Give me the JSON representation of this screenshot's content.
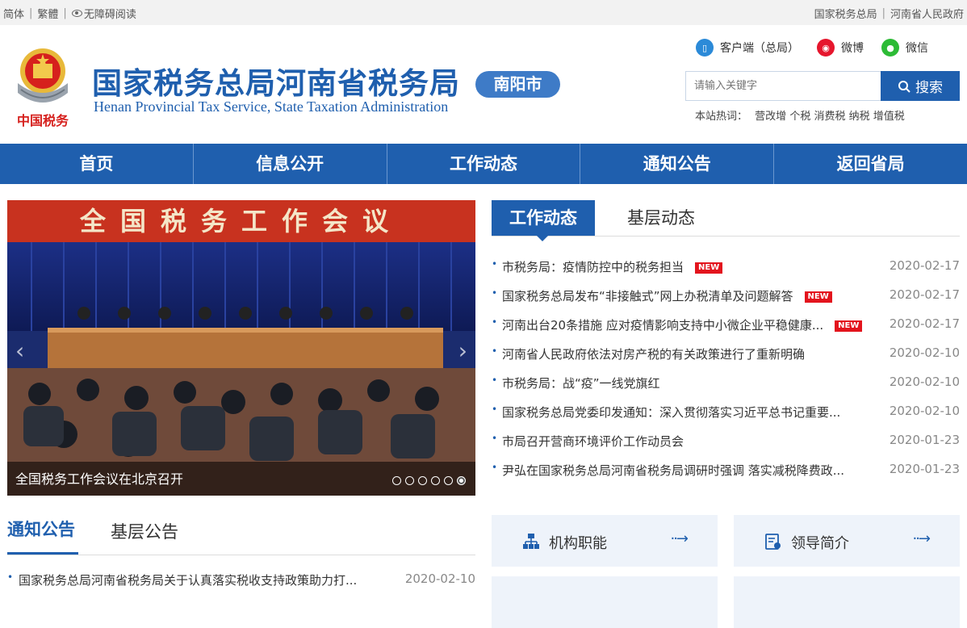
{
  "topbar": {
    "simplified": "简体",
    "traditional": "繁體",
    "accessibility": "无障碍阅读",
    "link_sat": "国家税务总局",
    "link_gov": "河南省人民政府"
  },
  "header": {
    "title": "国家税务总局河南省税务局",
    "title_en": "Henan Provincial Tax Service, State Taxation Administration",
    "city": "南阳市",
    "emblem_text": "中国税务",
    "client_link": "客户端（总局）",
    "weibo_link": "微博",
    "wechat_link": "微信"
  },
  "search": {
    "placeholder": "请输入关键字",
    "button": "搜索",
    "hot_label": "本站热词：",
    "hot_words": [
      "营改增",
      "个税",
      "消费税",
      "纳税",
      "增值税"
    ]
  },
  "nav": [
    "首页",
    "信息公开",
    "工作动态",
    "通知公告",
    "返回省局"
  ],
  "slider": {
    "banner_text": "全国税务工作会议",
    "caption": "全国税务工作会议在北京召开",
    "dot_count": 6,
    "active_dot": 5
  },
  "news": {
    "tab_active": "工作动态",
    "tab_other": "基层动态",
    "new_label": "NEW",
    "items": [
      {
        "title": "市税务局：疫情防控中的税务担当",
        "date": "2020-02-17",
        "is_new": true
      },
      {
        "title": "国家税务总局发布“非接触式”网上办税清单及问题解答",
        "date": "2020-02-17",
        "is_new": true
      },
      {
        "title": "河南出台20条措施 应对疫情影响支持中小微企业平稳健康...",
        "date": "2020-02-17",
        "is_new": true
      },
      {
        "title": "河南省人民政府依法对房产税的有关政策进行了重新明确",
        "date": "2020-02-10",
        "is_new": false
      },
      {
        "title": "市税务局：战“疫”一线党旗红",
        "date": "2020-02-10",
        "is_new": false
      },
      {
        "title": "国家税务总局党委印发通知：深入贯彻落实习近平总书记重要...",
        "date": "2020-02-10",
        "is_new": false
      },
      {
        "title": "市局召开营商环境评价工作动员会",
        "date": "2020-01-23",
        "is_new": false
      },
      {
        "title": "尹弘在国家税务总局河南省税务局调研时强调 落实减税降费政...",
        "date": "2020-01-23",
        "is_new": false
      }
    ]
  },
  "notice": {
    "tab_active": "通知公告",
    "tab_other": "基层公告",
    "items": [
      {
        "title": "国家税务总局河南省税务局关于认真落实税收支持政策助力打...",
        "date": "2020-02-10"
      }
    ]
  },
  "quick": {
    "org": "机构职能",
    "leaders": "领导简介",
    "arrow": "··→"
  },
  "colors": {
    "brand_blue": "#1f5fae",
    "badge_blue": "#3e7bc7",
    "new_red": "#e3141d",
    "light_box": "#eef3fa"
  }
}
